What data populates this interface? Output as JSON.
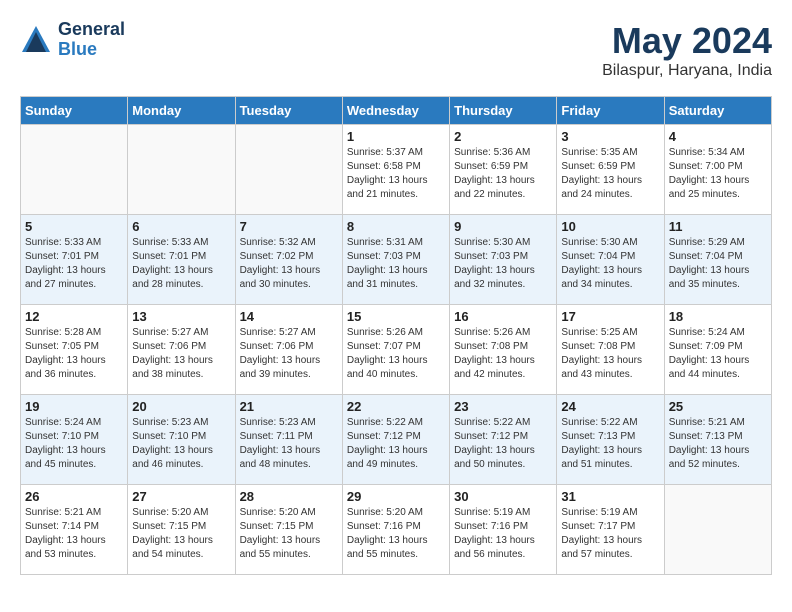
{
  "header": {
    "logo_general": "General",
    "logo_blue": "Blue",
    "title": "May 2024",
    "subtitle": "Bilaspur, Haryana, India"
  },
  "weekdays": [
    "Sunday",
    "Monday",
    "Tuesday",
    "Wednesday",
    "Thursday",
    "Friday",
    "Saturday"
  ],
  "weeks": [
    [
      {
        "num": "",
        "info": ""
      },
      {
        "num": "",
        "info": ""
      },
      {
        "num": "",
        "info": ""
      },
      {
        "num": "1",
        "info": "Sunrise: 5:37 AM\nSunset: 6:58 PM\nDaylight: 13 hours\nand 21 minutes."
      },
      {
        "num": "2",
        "info": "Sunrise: 5:36 AM\nSunset: 6:59 PM\nDaylight: 13 hours\nand 22 minutes."
      },
      {
        "num": "3",
        "info": "Sunrise: 5:35 AM\nSunset: 6:59 PM\nDaylight: 13 hours\nand 24 minutes."
      },
      {
        "num": "4",
        "info": "Sunrise: 5:34 AM\nSunset: 7:00 PM\nDaylight: 13 hours\nand 25 minutes."
      }
    ],
    [
      {
        "num": "5",
        "info": "Sunrise: 5:33 AM\nSunset: 7:01 PM\nDaylight: 13 hours\nand 27 minutes."
      },
      {
        "num": "6",
        "info": "Sunrise: 5:33 AM\nSunset: 7:01 PM\nDaylight: 13 hours\nand 28 minutes."
      },
      {
        "num": "7",
        "info": "Sunrise: 5:32 AM\nSunset: 7:02 PM\nDaylight: 13 hours\nand 30 minutes."
      },
      {
        "num": "8",
        "info": "Sunrise: 5:31 AM\nSunset: 7:03 PM\nDaylight: 13 hours\nand 31 minutes."
      },
      {
        "num": "9",
        "info": "Sunrise: 5:30 AM\nSunset: 7:03 PM\nDaylight: 13 hours\nand 32 minutes."
      },
      {
        "num": "10",
        "info": "Sunrise: 5:30 AM\nSunset: 7:04 PM\nDaylight: 13 hours\nand 34 minutes."
      },
      {
        "num": "11",
        "info": "Sunrise: 5:29 AM\nSunset: 7:04 PM\nDaylight: 13 hours\nand 35 minutes."
      }
    ],
    [
      {
        "num": "12",
        "info": "Sunrise: 5:28 AM\nSunset: 7:05 PM\nDaylight: 13 hours\nand 36 minutes."
      },
      {
        "num": "13",
        "info": "Sunrise: 5:27 AM\nSunset: 7:06 PM\nDaylight: 13 hours\nand 38 minutes."
      },
      {
        "num": "14",
        "info": "Sunrise: 5:27 AM\nSunset: 7:06 PM\nDaylight: 13 hours\nand 39 minutes."
      },
      {
        "num": "15",
        "info": "Sunrise: 5:26 AM\nSunset: 7:07 PM\nDaylight: 13 hours\nand 40 minutes."
      },
      {
        "num": "16",
        "info": "Sunrise: 5:26 AM\nSunset: 7:08 PM\nDaylight: 13 hours\nand 42 minutes."
      },
      {
        "num": "17",
        "info": "Sunrise: 5:25 AM\nSunset: 7:08 PM\nDaylight: 13 hours\nand 43 minutes."
      },
      {
        "num": "18",
        "info": "Sunrise: 5:24 AM\nSunset: 7:09 PM\nDaylight: 13 hours\nand 44 minutes."
      }
    ],
    [
      {
        "num": "19",
        "info": "Sunrise: 5:24 AM\nSunset: 7:10 PM\nDaylight: 13 hours\nand 45 minutes."
      },
      {
        "num": "20",
        "info": "Sunrise: 5:23 AM\nSunset: 7:10 PM\nDaylight: 13 hours\nand 46 minutes."
      },
      {
        "num": "21",
        "info": "Sunrise: 5:23 AM\nSunset: 7:11 PM\nDaylight: 13 hours\nand 48 minutes."
      },
      {
        "num": "22",
        "info": "Sunrise: 5:22 AM\nSunset: 7:12 PM\nDaylight: 13 hours\nand 49 minutes."
      },
      {
        "num": "23",
        "info": "Sunrise: 5:22 AM\nSunset: 7:12 PM\nDaylight: 13 hours\nand 50 minutes."
      },
      {
        "num": "24",
        "info": "Sunrise: 5:22 AM\nSunset: 7:13 PM\nDaylight: 13 hours\nand 51 minutes."
      },
      {
        "num": "25",
        "info": "Sunrise: 5:21 AM\nSunset: 7:13 PM\nDaylight: 13 hours\nand 52 minutes."
      }
    ],
    [
      {
        "num": "26",
        "info": "Sunrise: 5:21 AM\nSunset: 7:14 PM\nDaylight: 13 hours\nand 53 minutes."
      },
      {
        "num": "27",
        "info": "Sunrise: 5:20 AM\nSunset: 7:15 PM\nDaylight: 13 hours\nand 54 minutes."
      },
      {
        "num": "28",
        "info": "Sunrise: 5:20 AM\nSunset: 7:15 PM\nDaylight: 13 hours\nand 55 minutes."
      },
      {
        "num": "29",
        "info": "Sunrise: 5:20 AM\nSunset: 7:16 PM\nDaylight: 13 hours\nand 55 minutes."
      },
      {
        "num": "30",
        "info": "Sunrise: 5:19 AM\nSunset: 7:16 PM\nDaylight: 13 hours\nand 56 minutes."
      },
      {
        "num": "31",
        "info": "Sunrise: 5:19 AM\nSunset: 7:17 PM\nDaylight: 13 hours\nand 57 minutes."
      },
      {
        "num": "",
        "info": ""
      }
    ]
  ]
}
